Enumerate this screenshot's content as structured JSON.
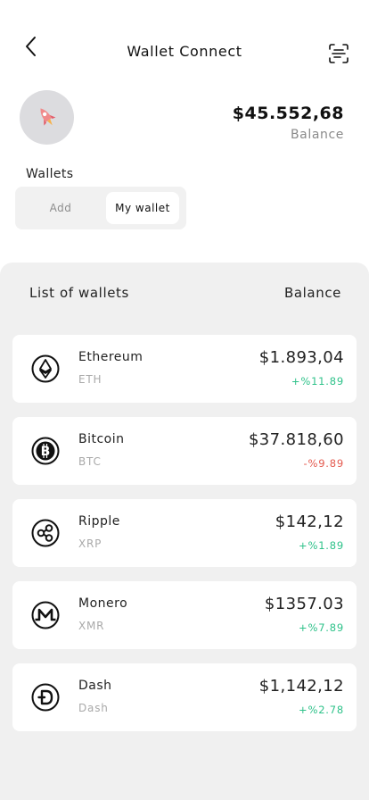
{
  "header": {
    "title": "Wallet Connect",
    "back_icon": "chevron-left-icon",
    "scan_icon": "scan-document-icon"
  },
  "profile": {
    "avatar_icon": "rocket-icon",
    "balance": "$45.552,68",
    "balance_caption": "Balance"
  },
  "wallets": {
    "label": "Wallets",
    "tabs": [
      {
        "label": "Add",
        "selected": false
      },
      {
        "label": "My wallet",
        "selected": true
      }
    ]
  },
  "list": {
    "heading": "List of wallets",
    "balance_heading": "Balance",
    "items": [
      {
        "name": "Ethereum",
        "symbol": "ETH",
        "value": "$1.893,04",
        "change": "+%11.89",
        "trend": "up",
        "icon": "ethereum-icon"
      },
      {
        "name": "Bitcoin",
        "symbol": "BTC",
        "value": "$37.818,60",
        "change": "-%9.89",
        "trend": "down",
        "icon": "bitcoin-icon"
      },
      {
        "name": "Ripple",
        "symbol": "XRP",
        "value": "$142,12",
        "change": "+%1.89",
        "trend": "up",
        "icon": "ripple-icon"
      },
      {
        "name": "Monero",
        "symbol": "XMR",
        "value": "$1357.03",
        "change": "+%7.89",
        "trend": "up",
        "icon": "monero-icon"
      },
      {
        "name": "Dash",
        "symbol": "Dash",
        "value": "$1,142,12",
        "change": "+%2.78",
        "trend": "up",
        "icon": "dash-icon"
      }
    ]
  },
  "colors": {
    "up": "#2fc28a",
    "down": "#e45a4f",
    "panel_bg": "#f0f0f0",
    "card_bg": "#ffffff",
    "avatar_bg": "#dcdcdf"
  }
}
